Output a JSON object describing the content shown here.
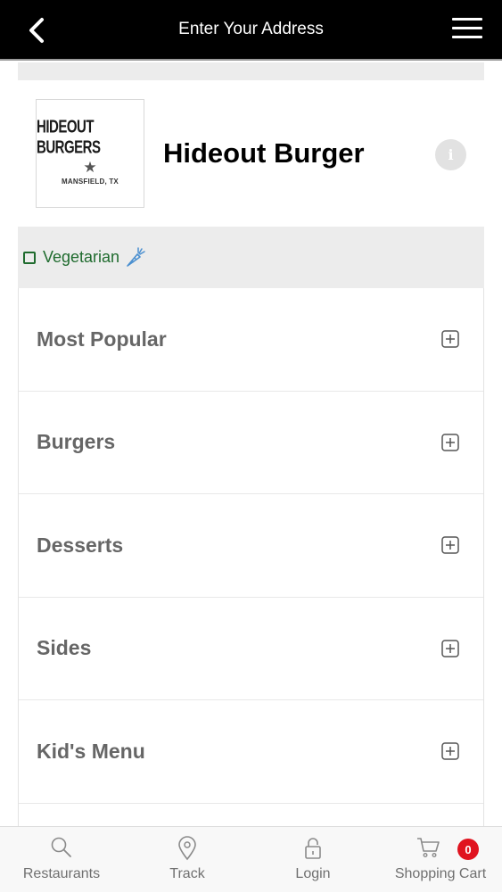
{
  "header": {
    "title": "Enter Your Address",
    "back_icon": "chevron-left-icon",
    "menu_icon": "hamburger-menu-icon"
  },
  "restaurant": {
    "name": "Hideout Burger",
    "logo": {
      "title": "HIDEOUT BURGERS",
      "star": "★",
      "location": "MANSFIELD, TX"
    },
    "info_icon_glyph": "i"
  },
  "filters": {
    "vegetarian_label": "Vegetarian",
    "vegetarian_checked": false,
    "vegetarian_icon": "carrot-icon"
  },
  "categories": [
    {
      "label": "Most Popular"
    },
    {
      "label": "Burgers"
    },
    {
      "label": "Desserts"
    },
    {
      "label": "Sides"
    },
    {
      "label": "Kid's Menu"
    },
    {
      "label": ""
    }
  ],
  "tabbar": {
    "items": [
      {
        "label": "Restaurants",
        "icon": "search-icon"
      },
      {
        "label": "Track",
        "icon": "location-pin-icon"
      },
      {
        "label": "Login",
        "icon": "lock-icon"
      },
      {
        "label": "Shopping Cart",
        "icon": "cart-icon"
      }
    ],
    "cart_count": "0"
  },
  "colors": {
    "header_bg": "#000000",
    "veg_green": "#1f6b2e",
    "badge_red": "#e0131f",
    "category_text": "#666666"
  }
}
